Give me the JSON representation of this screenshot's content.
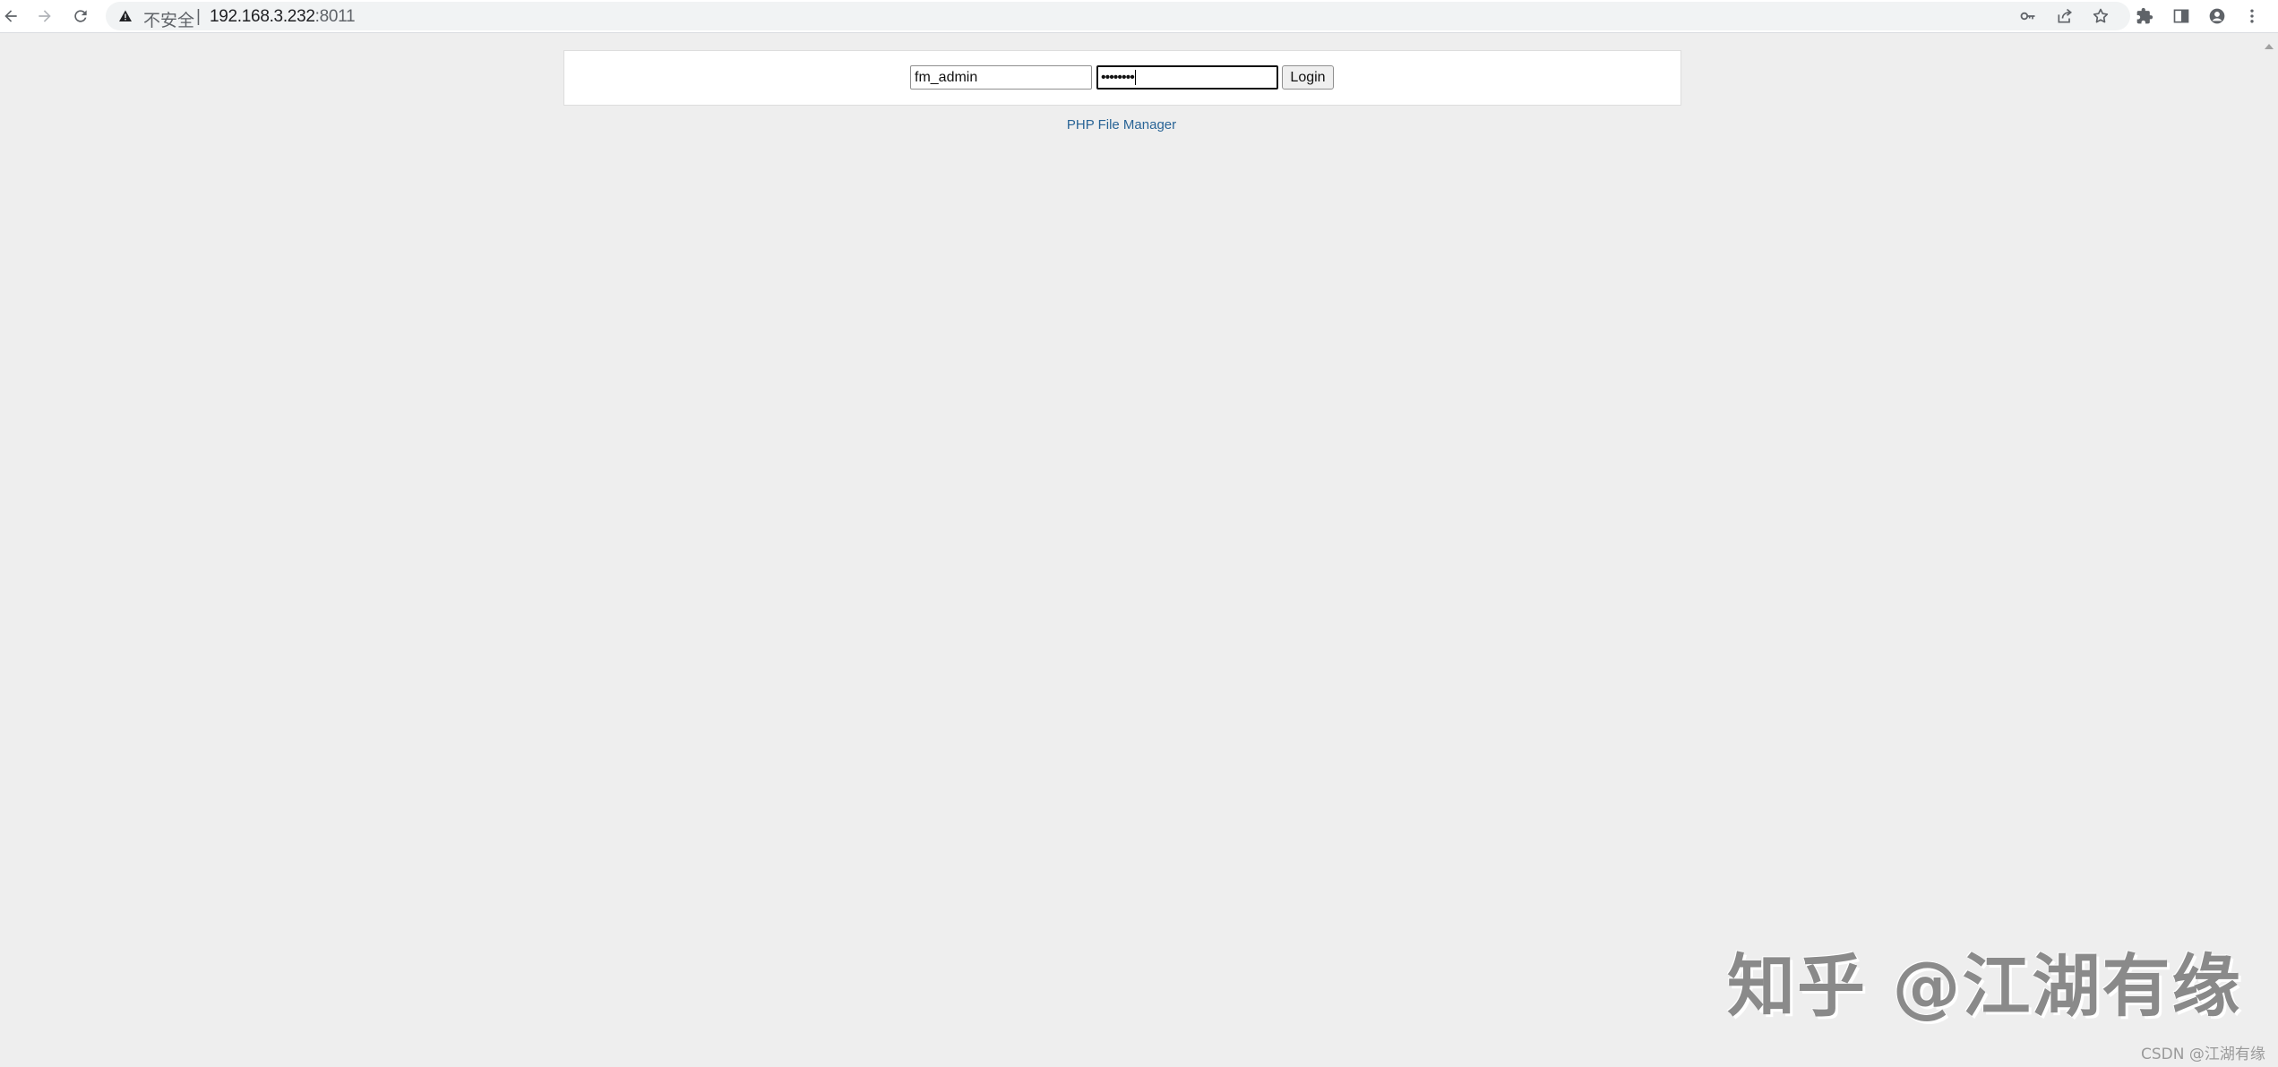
{
  "browser": {
    "insecure_label": "不安全",
    "divider": "|",
    "url_host": "192.168.3.232",
    "url_port": ":8011",
    "icons": [
      "back-icon",
      "forward-icon",
      "reload-icon",
      "warning-icon",
      "key-icon",
      "share-icon",
      "star-icon",
      "extensions-icon",
      "sidebar-icon",
      "profile-icon",
      "menu-icon"
    ]
  },
  "login": {
    "username_value": "fm_admin",
    "password_mask": "••••••••",
    "button_label": "Login"
  },
  "footer": {
    "link_text": "PHP File Manager"
  },
  "watermark": {
    "large": "知乎 @江湖有缘",
    "small": "CSDN @江湖有缘"
  },
  "colors": {
    "page_bg": "#eeeeee",
    "link": "#296496"
  }
}
